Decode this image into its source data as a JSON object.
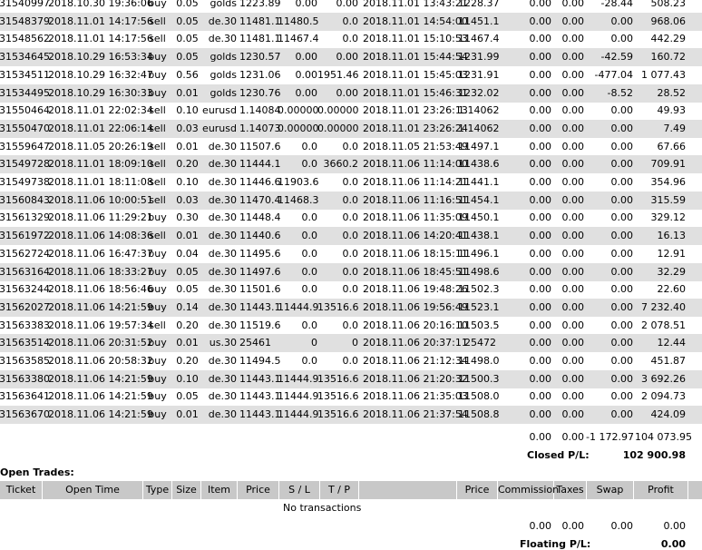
{
  "closed_trades": [
    [
      "31540997",
      "2018.10.30 19:36:06",
      "buy",
      "0.05",
      "golds",
      "1223.89",
      "0.00",
      "0.00",
      "2018.11.01 13:43:21",
      "1228.37",
      "0.00",
      "0.00",
      "-28.44",
      "508.23"
    ],
    [
      "31548379",
      "2018.11.01 14:17:56",
      "sell",
      "0.05",
      "de.30",
      "11481.1",
      "11480.5",
      "0.0",
      "2018.11.01 14:54:00",
      "11451.1",
      "0.00",
      "0.00",
      "0.00",
      "968.06"
    ],
    [
      "31548562",
      "2018.11.01 14:17:56",
      "sell",
      "0.05",
      "de.30",
      "11481.1",
      "11467.4",
      "0.0",
      "2018.11.01 15:10:53",
      "11467.4",
      "0.00",
      "0.00",
      "0.00",
      "442.29"
    ],
    [
      "31534645",
      "2018.10.29 16:53:34",
      "buy",
      "0.05",
      "golds",
      "1230.57",
      "0.00",
      "0.00",
      "2018.11.01 15:44:54",
      "1231.99",
      "0.00",
      "0.00",
      "-42.59",
      "160.72"
    ],
    [
      "31534511",
      "2018.10.29 16:32:47",
      "buy",
      "0.56",
      "golds",
      "1231.06",
      "0.00",
      "1951.46",
      "2018.11.01 15:45:03",
      "1231.91",
      "0.00",
      "0.00",
      "-477.04",
      "1 077.43"
    ],
    [
      "31534495",
      "2018.10.29 16:30:33",
      "buy",
      "0.01",
      "golds",
      "1230.76",
      "0.00",
      "0.00",
      "2018.11.01 15:46:31",
      "1232.02",
      "0.00",
      "0.00",
      "-8.52",
      "28.52"
    ],
    [
      "31550464",
      "2018.11.01 22:02:34",
      "sell",
      "0.10",
      "eurusd",
      "1.14084",
      "0.00000",
      "0.00000",
      "2018.11.01 23:26:13",
      "1.14062",
      "0.00",
      "0.00",
      "0.00",
      "49.93"
    ],
    [
      "31550470",
      "2018.11.01 22:06:14",
      "sell",
      "0.03",
      "eurusd",
      "1.14073",
      "0.00000",
      "0.00000",
      "2018.11.01 23:26:24",
      "1.14062",
      "0.00",
      "0.00",
      "0.00",
      "7.49"
    ],
    [
      "31559647",
      "2018.11.05 20:26:19",
      "sell",
      "0.01",
      "de.30",
      "11507.6",
      "0.0",
      "0.0",
      "2018.11.05 21:53:49",
      "11497.1",
      "0.00",
      "0.00",
      "0.00",
      "67.66"
    ],
    [
      "31549728",
      "2018.11.01 18:09:10",
      "sell",
      "0.20",
      "de.30",
      "11444.1",
      "0.0",
      "3660.2",
      "2018.11.06 11:14:00",
      "11438.6",
      "0.00",
      "0.00",
      "0.00",
      "709.91"
    ],
    [
      "31549738",
      "2018.11.01 18:11:08",
      "sell",
      "0.10",
      "de.30",
      "11446.6",
      "11903.6",
      "0.0",
      "2018.11.06 11:14:21",
      "11441.1",
      "0.00",
      "0.00",
      "0.00",
      "354.96"
    ],
    [
      "31560843",
      "2018.11.06 10:00:51",
      "sell",
      "0.03",
      "de.30",
      "11470.4",
      "11468.3",
      "0.0",
      "2018.11.06 11:16:51",
      "11454.1",
      "0.00",
      "0.00",
      "0.00",
      "315.59"
    ],
    [
      "31561329",
      "2018.11.06 11:29:21",
      "buy",
      "0.30",
      "de.30",
      "11448.4",
      "0.0",
      "0.0",
      "2018.11.06 11:35:09",
      "11450.1",
      "0.00",
      "0.00",
      "0.00",
      "329.12"
    ],
    [
      "31561972",
      "2018.11.06 14:08:36",
      "sell",
      "0.01",
      "de.30",
      "11440.6",
      "0.0",
      "0.0",
      "2018.11.06 14:20:41",
      "11438.1",
      "0.00",
      "0.00",
      "0.00",
      "16.13"
    ],
    [
      "31562724",
      "2018.11.06 16:47:37",
      "buy",
      "0.04",
      "de.30",
      "11495.6",
      "0.0",
      "0.0",
      "2018.11.06 18:15:11",
      "11496.1",
      "0.00",
      "0.00",
      "0.00",
      "12.91"
    ],
    [
      "31563164",
      "2018.11.06 18:33:27",
      "buy",
      "0.05",
      "de.30",
      "11497.6",
      "0.0",
      "0.0",
      "2018.11.06 18:45:51",
      "11498.6",
      "0.00",
      "0.00",
      "0.00",
      "32.29"
    ],
    [
      "31563244",
      "2018.11.06 18:56:46",
      "buy",
      "0.05",
      "de.30",
      "11501.6",
      "0.0",
      "0.0",
      "2018.11.06 19:48:26",
      "11502.3",
      "0.00",
      "0.00",
      "0.00",
      "22.60"
    ],
    [
      "31562027",
      "2018.11.06 14:21:59",
      "buy",
      "0.14",
      "de.30",
      "11443.1",
      "11444.9",
      "13516.6",
      "2018.11.06 19:56:49",
      "11523.1",
      "0.00",
      "0.00",
      "0.00",
      "7 232.40"
    ],
    [
      "31563383",
      "2018.11.06 19:57:34",
      "sell",
      "0.20",
      "de.30",
      "11519.6",
      "0.0",
      "0.0",
      "2018.11.06 20:16:10",
      "11503.5",
      "0.00",
      "0.00",
      "0.00",
      "2 078.51"
    ],
    [
      "31563514",
      "2018.11.06 20:31:52",
      "buy",
      "0.01",
      "us.30",
      "25461",
      "0",
      "0",
      "2018.11.06 20:37:11",
      "25472",
      "0.00",
      "0.00",
      "0.00",
      "12.44"
    ],
    [
      "31563585",
      "2018.11.06 20:58:32",
      "buy",
      "0.20",
      "de.30",
      "11494.5",
      "0.0",
      "0.0",
      "2018.11.06 21:12:34",
      "11498.0",
      "0.00",
      "0.00",
      "0.00",
      "451.87"
    ],
    [
      "31563380",
      "2018.11.06 14:21:59",
      "buy",
      "0.10",
      "de.30",
      "11443.1",
      "11444.9",
      "13516.6",
      "2018.11.06 21:20:32",
      "11500.3",
      "0.00",
      "0.00",
      "0.00",
      "3 692.26"
    ],
    [
      "31563641",
      "2018.11.06 14:21:59",
      "buy",
      "0.05",
      "de.30",
      "11443.1",
      "11444.9",
      "13516.6",
      "2018.11.06 21:35:03",
      "11508.0",
      "0.00",
      "0.00",
      "0.00",
      "2 094.73"
    ],
    [
      "31563670",
      "2018.11.06 14:21:59",
      "buy",
      "0.01",
      "de.30",
      "11443.1",
      "11444.9",
      "13516.6",
      "2018.11.06 21:37:54",
      "11508.8",
      "0.00",
      "0.00",
      "0.00",
      "424.09"
    ]
  ],
  "closed_totals": {
    "commission": "0.00",
    "taxes": "0.00",
    "swap": "-1 172.97",
    "profit": "104 073.95"
  },
  "closed_pl": {
    "label": "Closed P/L:",
    "value": "102 900.98"
  },
  "open_trades": {
    "title": "Open Trades:",
    "headers": [
      "Ticket",
      "Open Time",
      "Type",
      "Size",
      "Item",
      "Price",
      "S / L",
      "T / P",
      "",
      "Price",
      "Commission",
      "Taxes",
      "Swap",
      "Profit"
    ],
    "empty_text": "No transactions",
    "totals": {
      "commission": "0.00",
      "taxes": "0.00",
      "swap": "0.00",
      "profit": "0.00"
    }
  },
  "floating_pl": {
    "label": "Floating P/L:",
    "value": "0.00"
  }
}
